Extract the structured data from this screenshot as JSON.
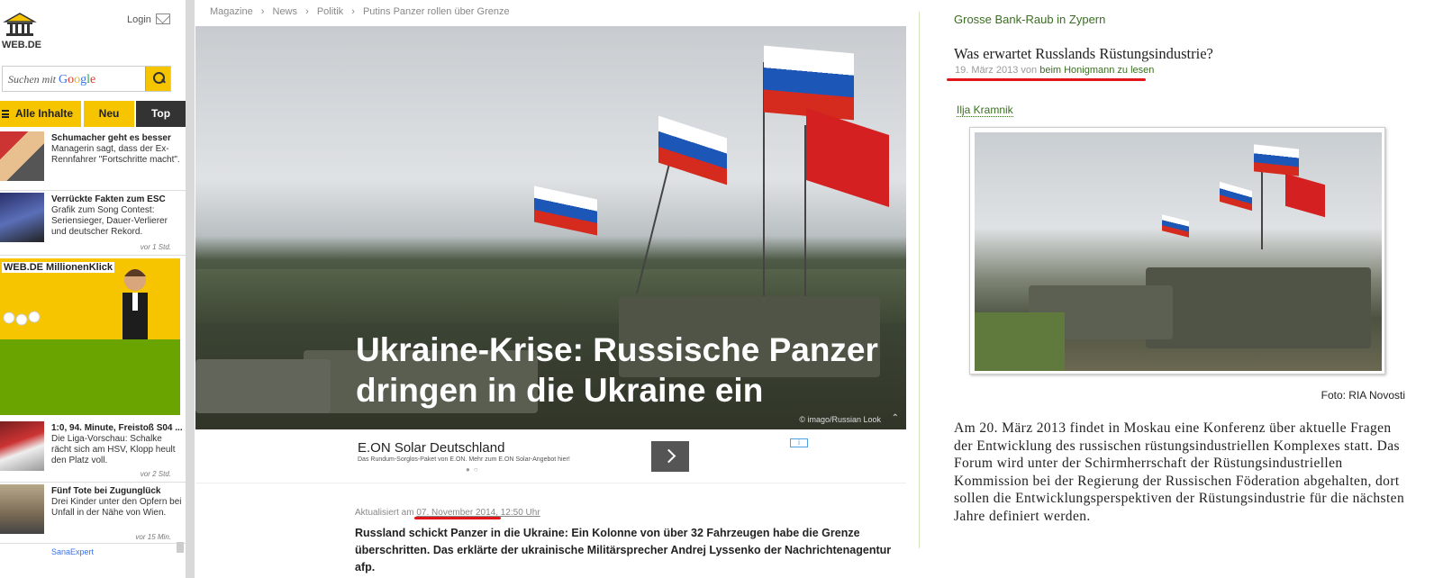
{
  "left": {
    "logo_text": "WEB.DE",
    "login": "Login",
    "search_placeholder_prefix": "Suchen mit",
    "search_brand": "Google",
    "tabs": [
      "Alle Inhalte",
      "Neu",
      "Top"
    ],
    "news": [
      {
        "title": "Schumacher geht es besser",
        "desc": "Managerin sagt, dass der Ex-Rennfahrer \"Fortschritte macht\".",
        "time": ""
      },
      {
        "title": "Verrückte Fakten zum ESC",
        "desc": "Grafik zum Song Contest: Seriensieger, Dauer-Verlierer und deutscher Rekord.",
        "time": "vor 1 Std."
      },
      {
        "title": "1:0, 94. Minute, Freistoß S04 ...",
        "desc": "Die Liga-Vorschau: Schalke rächt sich am HSV, Klopp heult den Platz voll.",
        "time": "vor 2 Std."
      },
      {
        "title": "Fünf Tote bei Zugunglück",
        "desc": "Drei Kinder unter den Opfern bei Unfall in der Nähe von Wien.",
        "time": "vor 15 Min."
      }
    ],
    "millionenklick": "WEB.DE  MillionenKlick",
    "bottom_partial": "SanaExpert"
  },
  "middle": {
    "breadcrumb": [
      "Magazine",
      "News",
      "Politik",
      "Putins Panzer rollen über Grenze"
    ],
    "hero_title": "Ukraine-Krise: Russische Panzer dringen in die Ukraine ein",
    "hero_credit": "© imago/Russian Look",
    "ad_title": "E.ON Solar Deutschland",
    "ad_sub": "Das Rundum-Sorglos-Paket von E.ON. Mehr zum E.ON Solar-Angebot hier!",
    "updated_prefix": "Aktualisiert am",
    "updated_date": "07. November 2014, 12:50 Uhr",
    "lead": "Russland schickt Panzer in die Ukraine: Ein Kolonne von über 32 Fahrzeugen habe die Grenze überschritten. Das erklärte der ukrainische Militärsprecher Andrej Lyssenko der Nachrichtenagentur afp."
  },
  "right": {
    "top_link": "Grosse Bank-Raub in Zypern",
    "title": "Was erwartet Russlands Rüstungsindustrie?",
    "meta_date": "19. März 2013",
    "meta_von": "von",
    "meta_author": "beim Honigmann",
    "meta_suffix": "zu lesen",
    "author": "Ilja Kramnik",
    "caption": "Foto: RIA Novosti",
    "body": "Am 20. März 2013 findet in Moskau eine Konferenz über aktuelle Fragen der Entwicklung des russischen rüstungsindustriellen Komplexes statt. Das Forum wird unter der Schirmherrschaft der Rüstungsindustriellen Kommission bei der Regierung der Russischen Föderation abgehalten, dort sollen die Entwicklungsperspektiven der Rüstungsindustrie für die nächsten Jahre definiert werden."
  },
  "colors": {
    "accent": "#f7c500",
    "highlight": "#e0161b",
    "link": "#3b6e22"
  }
}
